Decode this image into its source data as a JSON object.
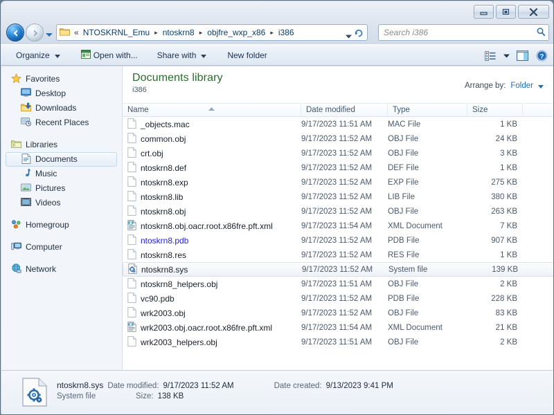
{
  "window": {
    "controls": [
      {
        "name": "minimize-button",
        "glyph": "minimize"
      },
      {
        "name": "maximize-restore-button",
        "glyph": "restore"
      },
      {
        "name": "close-button",
        "glyph": "close"
      }
    ]
  },
  "address_bar": {
    "back_icon": "back-arrow-icon",
    "forward_icon": "forward-arrow-icon",
    "history_icon": "chevron-down-icon",
    "folder_icon": "folder-icon",
    "overflow": "«",
    "crumbs": [
      "NTOSKRNL_Emu",
      "ntoskrn8",
      "objfre_wxp_x86",
      "i386"
    ],
    "separator": "▸",
    "dropdown_icon": "chevron-down-icon",
    "refresh_icon": "refresh-icon"
  },
  "search": {
    "placeholder": "Search i386",
    "icon": "search-icon"
  },
  "toolbar": {
    "organize_label": "Organize",
    "open_with_label": "Open with...",
    "share_with_label": "Share with",
    "new_folder_label": "New folder",
    "open_with_icon": "program-window-icon",
    "views_icon": "view-list-icon",
    "views_caret_icon": "chevron-down-icon",
    "preview_pane_icon": "preview-pane-icon",
    "help_icon": "help-question-icon"
  },
  "sidebar": {
    "groups": [
      {
        "header": {
          "label": "Favorites",
          "icon": "star-icon",
          "name": "sidebar-group-favorites"
        },
        "items": [
          {
            "label": "Desktop",
            "icon": "desktop-icon",
            "name": "sidebar-item-desktop",
            "selected": false
          },
          {
            "label": "Downloads",
            "icon": "downloads-icon",
            "name": "sidebar-item-downloads",
            "selected": false
          },
          {
            "label": "Recent Places",
            "icon": "recent-places-icon",
            "name": "sidebar-item-recent-places",
            "selected": false
          }
        ]
      },
      {
        "header": {
          "label": "Libraries",
          "icon": "libraries-icon",
          "name": "sidebar-group-libraries"
        },
        "items": [
          {
            "label": "Documents",
            "icon": "documents-icon",
            "name": "sidebar-item-documents",
            "selected": true
          },
          {
            "label": "Music",
            "icon": "music-icon",
            "name": "sidebar-item-music",
            "selected": false
          },
          {
            "label": "Pictures",
            "icon": "pictures-icon",
            "name": "sidebar-item-pictures",
            "selected": false
          },
          {
            "label": "Videos",
            "icon": "videos-icon",
            "name": "sidebar-item-videos",
            "selected": false
          }
        ]
      },
      {
        "header": {
          "label": "Homegroup",
          "icon": "homegroup-icon",
          "name": "sidebar-group-homegroup"
        },
        "items": []
      },
      {
        "header": {
          "label": "Computer",
          "icon": "computer-icon",
          "name": "sidebar-group-computer"
        },
        "items": []
      },
      {
        "header": {
          "label": "Network",
          "icon": "network-icon",
          "name": "sidebar-group-network"
        },
        "items": []
      }
    ]
  },
  "library_header": {
    "title": "Documents library",
    "subtitle": "i386",
    "arrange_label": "Arrange by:",
    "arrange_value": "Folder",
    "arrange_caret_icon": "chevron-down-icon"
  },
  "file_list": {
    "columns": [
      {
        "label": "Name",
        "key": "name",
        "sorted": true,
        "sort_dir": "asc"
      },
      {
        "label": "Date modified",
        "key": "date"
      },
      {
        "label": "Type",
        "key": "type"
      },
      {
        "label": "Size",
        "key": "size"
      }
    ],
    "sort_indicator_icon": "sort-ascending-icon",
    "rows": [
      {
        "name": "_objects.mac",
        "date": "9/17/2023 11:51 AM",
        "type": "MAC File",
        "size": "1 KB",
        "icon": "generic-file-icon",
        "selected": false,
        "link": false
      },
      {
        "name": "common.obj",
        "date": "9/17/2023 11:52 AM",
        "type": "OBJ File",
        "size": "24 KB",
        "icon": "generic-file-icon",
        "selected": false,
        "link": false
      },
      {
        "name": "crt.obj",
        "date": "9/17/2023 11:52 AM",
        "type": "OBJ File",
        "size": "3 KB",
        "icon": "generic-file-icon",
        "selected": false,
        "link": false
      },
      {
        "name": "ntoskrn8.def",
        "date": "9/17/2023 11:52 AM",
        "type": "DEF File",
        "size": "1 KB",
        "icon": "generic-file-icon",
        "selected": false,
        "link": false
      },
      {
        "name": "ntoskrn8.exp",
        "date": "9/17/2023 11:52 AM",
        "type": "EXP File",
        "size": "275 KB",
        "icon": "generic-file-icon",
        "selected": false,
        "link": false
      },
      {
        "name": "ntoskrn8.lib",
        "date": "9/17/2023 11:52 AM",
        "type": "LIB File",
        "size": "380 KB",
        "icon": "generic-file-icon",
        "selected": false,
        "link": false
      },
      {
        "name": "ntoskrn8.obj",
        "date": "9/17/2023 11:52 AM",
        "type": "OBJ File",
        "size": "263 KB",
        "icon": "generic-file-icon",
        "selected": false,
        "link": false
      },
      {
        "name": "ntoskrn8.obj.oacr.root.x86fre.pft.xml",
        "date": "9/17/2023 11:54 AM",
        "type": "XML Document",
        "size": "7 KB",
        "icon": "xml-file-icon",
        "selected": false,
        "link": false
      },
      {
        "name": "ntoskrn8.pdb",
        "date": "9/17/2023 11:52 AM",
        "type": "PDB File",
        "size": "907 KB",
        "icon": "generic-file-icon",
        "selected": false,
        "link": true
      },
      {
        "name": "ntoskrn8.res",
        "date": "9/17/2023 11:52 AM",
        "type": "RES File",
        "size": "1 KB",
        "icon": "generic-file-icon",
        "selected": false,
        "link": false
      },
      {
        "name": "ntoskrn8.sys",
        "date": "9/17/2023 11:52 AM",
        "type": "System file",
        "size": "139 KB",
        "icon": "system-file-icon",
        "selected": true,
        "link": false
      },
      {
        "name": "ntoskrn8_helpers.obj",
        "date": "9/17/2023 11:51 AM",
        "type": "OBJ File",
        "size": "2 KB",
        "icon": "generic-file-icon",
        "selected": false,
        "link": false
      },
      {
        "name": "vc90.pdb",
        "date": "9/17/2023 11:52 AM",
        "type": "PDB File",
        "size": "228 KB",
        "icon": "generic-file-icon",
        "selected": false,
        "link": false
      },
      {
        "name": "wrk2003.obj",
        "date": "9/17/2023 11:52 AM",
        "type": "OBJ File",
        "size": "83 KB",
        "icon": "generic-file-icon",
        "selected": false,
        "link": false
      },
      {
        "name": "wrk2003.obj.oacr.root.x86fre.pft.xml",
        "date": "9/17/2023 11:54 AM",
        "type": "XML Document",
        "size": "21 KB",
        "icon": "xml-file-icon",
        "selected": false,
        "link": false
      },
      {
        "name": "wrk2003_helpers.obj",
        "date": "9/17/2023 11:51 AM",
        "type": "OBJ File",
        "size": "2 KB",
        "icon": "generic-file-icon",
        "selected": false,
        "link": false
      }
    ]
  },
  "details_pane": {
    "icon": "system-file-large-icon",
    "file_name": "ntoskrn8.sys",
    "file_type": "System file",
    "date_modified_label": "Date modified:",
    "date_modified_value": "9/17/2023 11:52 AM",
    "size_label": "Size:",
    "size_value": "138 KB",
    "date_created_label": "Date created:",
    "date_created_value": "9/13/2023 9:41 PM"
  },
  "colors": {
    "library_title": "#2c6a2c",
    "link_text": "#1b6fbe",
    "blue_filename": "#2121d8",
    "window_chrome": "#cfd9e6"
  }
}
